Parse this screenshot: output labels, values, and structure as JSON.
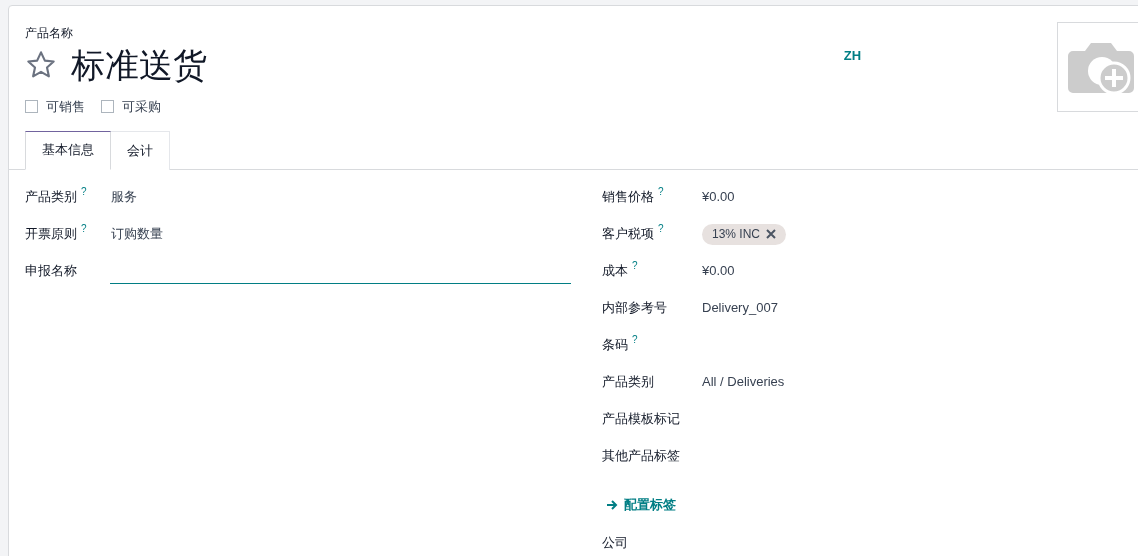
{
  "product_label": "产品名称",
  "product_name": "标准送货",
  "favorite": false,
  "language": "ZH",
  "checkboxes": [
    {
      "label": "可销售",
      "checked": false
    },
    {
      "label": "可采购",
      "checked": false
    }
  ],
  "tabs": [
    {
      "label": "基本信息",
      "selected": true
    },
    {
      "label": "会计",
      "selected": false
    }
  ],
  "left_fields": [
    {
      "kind": "text",
      "label": "产品类别",
      "help": "?",
      "value": "服务"
    },
    {
      "kind": "text",
      "label": "开票原则",
      "help": "?",
      "value": "订购数量"
    },
    {
      "kind": "input",
      "label": "申报名称"
    }
  ],
  "right_fields": [
    {
      "kind": "text",
      "label": "销售价格",
      "help": "?",
      "value": "¥0.00"
    },
    {
      "kind": "tag",
      "label": "客户税项",
      "help": "?",
      "value": "13% INC"
    },
    {
      "kind": "text",
      "label": "成本",
      "help": "?",
      "value": "¥0.00"
    },
    {
      "kind": "text",
      "label": "内部参考号",
      "value": "Delivery_007"
    },
    {
      "kind": "text",
      "label": "条码",
      "help": "?"
    },
    {
      "kind": "text",
      "label": "产品类别",
      "value": "All / Deliveries"
    },
    {
      "kind": "text",
      "label": "产品模板标记"
    },
    {
      "kind": "text",
      "label": "其他产品标签"
    },
    {
      "kind": "link",
      "label": "配置标签"
    },
    {
      "kind": "text",
      "label": "公司"
    }
  ]
}
